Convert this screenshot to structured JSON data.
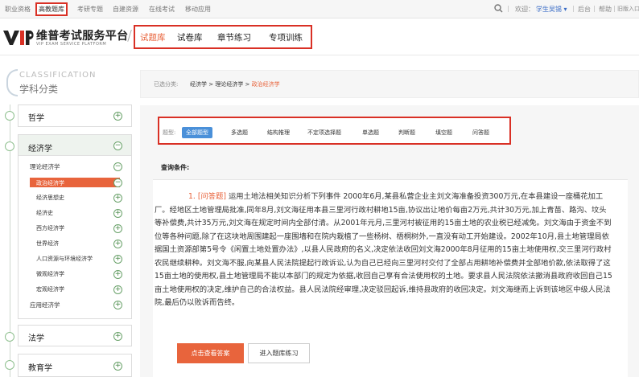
{
  "topbar": {
    "links": [
      "职业资格",
      "高教题库",
      "考研专题",
      "自建资源",
      "在线考试",
      "移动应用"
    ],
    "welcome_prefix": "欢迎：",
    "user": "学生吴锡 ▾",
    "sep": "|",
    "backstage": "后台",
    "help": "帮助",
    "old": "旧版入口"
  },
  "brand": {
    "title": "维普考试服务平台",
    "subtitle": "VIP EXAM SERVICE PLATFORM",
    "logo_small": "维普资讯"
  },
  "nav": {
    "tabs": [
      "试题库",
      "试卷库",
      "章节练习",
      "专项训练"
    ]
  },
  "category": {
    "title_en": "CLASSIFICATION",
    "title_cn": "学科分类",
    "items": {
      "philosophy": "哲学",
      "economics": "经济学",
      "law": "法学",
      "education": "教育学"
    },
    "sub": [
      "理论经济学",
      "政治经济学",
      "经济思想史",
      "经济史",
      "西方经济学",
      "世界经济",
      "人口资源与环境经济学",
      "微观经济学",
      "宏观经济学",
      "应用经济学"
    ]
  },
  "breadcrumb": {
    "prefix": "已选分类:",
    "path": "经济学 > 理论经济学 > ",
    "current": "政治经济学"
  },
  "filter": {
    "label": "题型:",
    "types": [
      "全部题型",
      "多选题",
      "结构推理",
      "不定项选择题",
      "单选题",
      "判断题",
      "填空题",
      "问答题"
    ]
  },
  "query_label": "查询条件:",
  "question": {
    "number": "1. [问答题]",
    "text": "运用土地法相关知识分析下列事件 2000年6月,某县私营企业主刘文海准备投资300万元,在本县建设一座桶花加工厂。经地区土地管理局批准,同年8月,刘文海征用本县三里河行政村耕地15亩,协议出让地价每亩2万元,共计30万元,加上青苗、路沟、坟头等补偿费,共计35万元,刘文海在规定时间内全部付清。从2001年元月,三里河村被征用的15亩土地的农业税已经减免。刘文海由于资金不到位等各种问题,除了在这块地周围建起一座围墙和在院内栽植了一些杨树、梧桐树外,一直没有动工开始建设。2002年10月,县土地管理局依据国土资源部第5号令《闲置土地处置办法》,以县人民政府的名义,决定依法收回刘文海2000年8月征用的15亩土地使用权,交三里河行政村农民继续耕种。刘文海不服,向某县人民法院提起行政诉讼,认为自己已经向三里河村交付了全部占用耕地补偿费并全部地价款,依法取得了这15亩土地的使用权,县土地管理局不能以本部门的规定为依据,收回自己享有合法使用权的土地。要求县人民法院依法撤消县政府收回自己15亩土地使用权的决定,维护自己的合法权益。县人民法院经审理,决定驳回起诉,维持县政府的收回决定。刘文海继而上诉到该地区中级人民法院,最后仍以败诉而告终。"
  },
  "buttons": {
    "answer": "点击查看答案",
    "practice": "进入题库练习"
  }
}
